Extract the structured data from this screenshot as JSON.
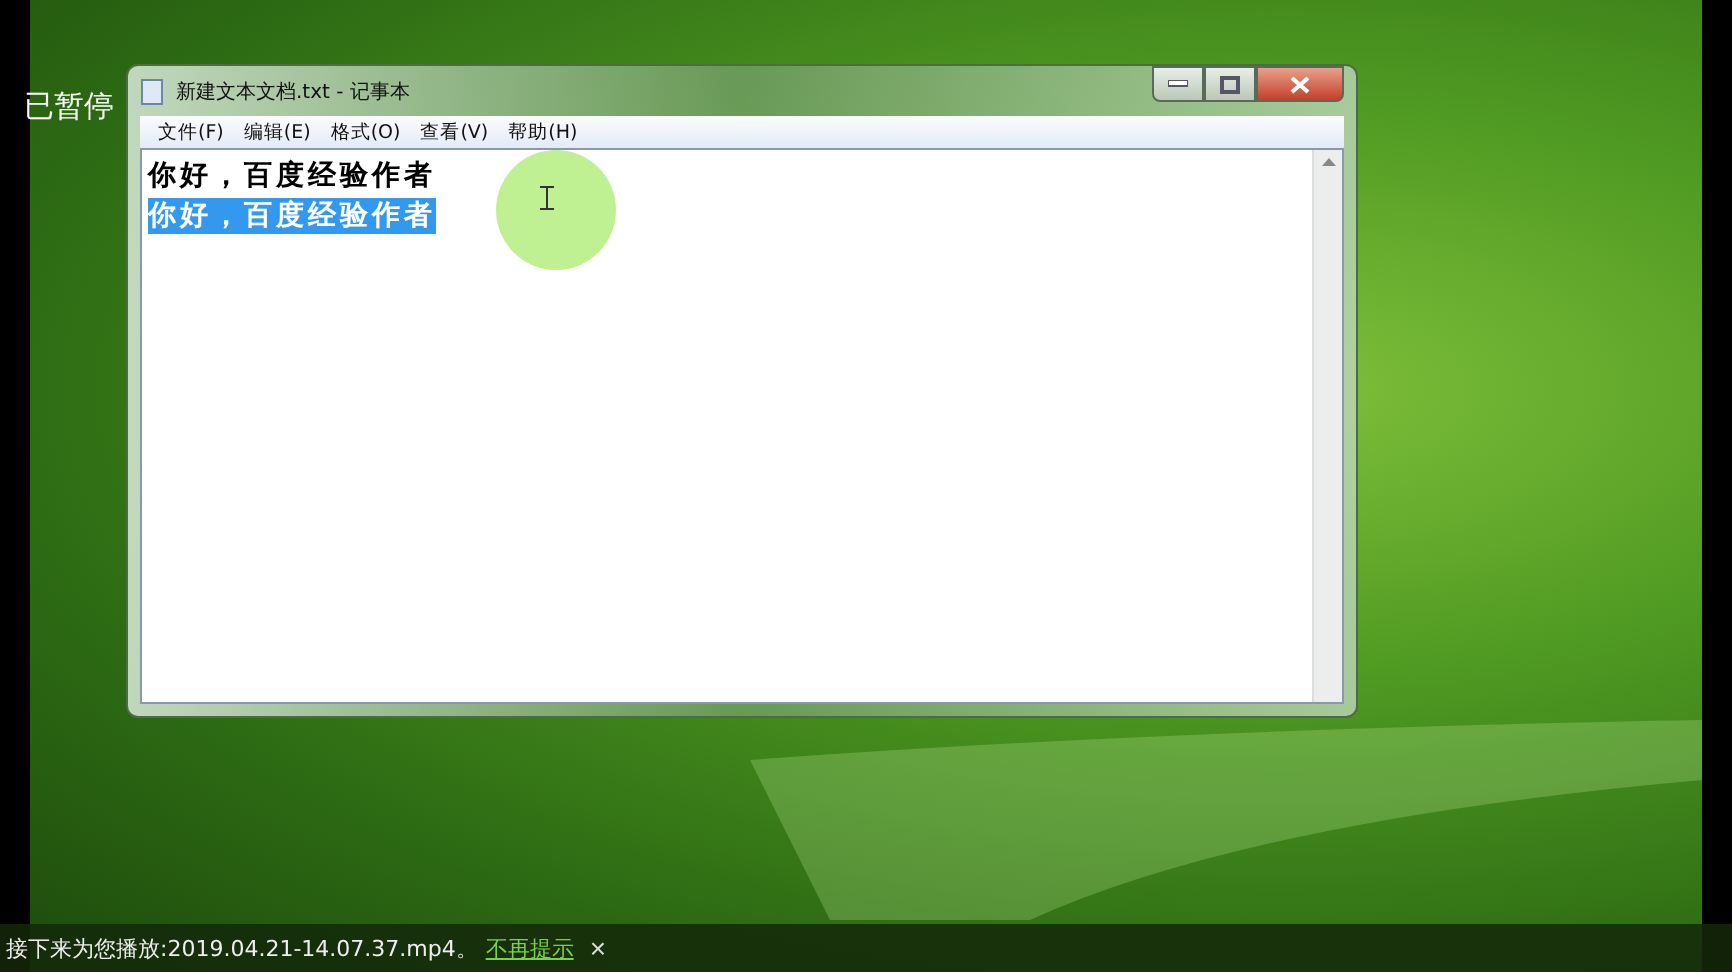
{
  "player": {
    "status": "已暂停"
  },
  "window": {
    "title": "新建文本文档.txt - 记事本"
  },
  "menu": [
    {
      "label": "文件(F)"
    },
    {
      "label": "编辑(E)"
    },
    {
      "label": "格式(O)"
    },
    {
      "label": "查看(V)"
    },
    {
      "label": "帮助(H)"
    }
  ],
  "lines": [
    {
      "text": "你好，百度经验作者",
      "selected": false
    },
    {
      "text": "你好，百度经验作者",
      "selected": true
    }
  ],
  "notice": {
    "text": "接下来为您播放:2019.04.21-14.07.37.mp4。",
    "link": "不再提示",
    "close": "×"
  }
}
